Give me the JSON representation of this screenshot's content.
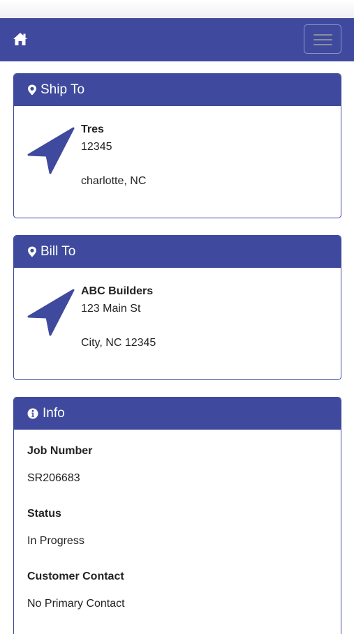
{
  "navbar": {
    "home_icon": "home-icon",
    "menu_icon": "hamburger-menu-icon",
    "bg_color": "#3f4a9e"
  },
  "ship_to": {
    "title": "Ship To",
    "icon": "map-marker-icon",
    "name": "Tres",
    "line1": "12345",
    "line2": "",
    "city_line": "charlotte, NC"
  },
  "bill_to": {
    "title": "Bill To",
    "icon": "map-marker-icon",
    "name": "ABC Builders",
    "line1": "123 Main St",
    "line2": "",
    "city_line": "City, NC 12345"
  },
  "info": {
    "title": "Info",
    "icon": "info-circle-icon",
    "fields": [
      {
        "label": "Job Number",
        "value": "SR206683"
      },
      {
        "label": "Status",
        "value": "In Progress"
      },
      {
        "label": "Customer Contact",
        "value": "No Primary Contact"
      }
    ]
  }
}
